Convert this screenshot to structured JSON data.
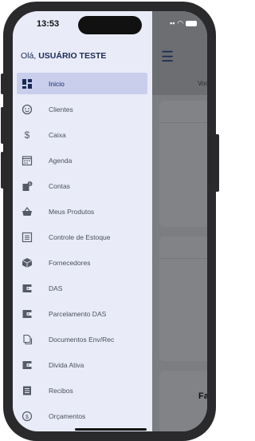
{
  "status_bar": {
    "time": "13:53"
  },
  "greeting": {
    "prefix": "Olá, ",
    "user": "USUÁRIO TESTE"
  },
  "menu": {
    "items": [
      {
        "label": "Inicio",
        "icon": "dashboard-icon",
        "active": true
      },
      {
        "label": "Clientes",
        "icon": "smiley-face-icon",
        "active": false
      },
      {
        "label": "Caixa",
        "icon": "dollar-icon",
        "active": false
      },
      {
        "label": "Agenda",
        "icon": "calendar-icon",
        "active": false
      },
      {
        "label": "Contas",
        "icon": "bill-icon",
        "active": false
      },
      {
        "label": "Meus Produtos",
        "icon": "basket-icon",
        "active": false
      },
      {
        "label": "Controle de Estoque",
        "icon": "inventory-list-icon",
        "active": false
      },
      {
        "label": "Fornecedores",
        "icon": "package-icon",
        "active": false
      },
      {
        "label": "DAS",
        "icon": "wallet-icon",
        "active": false
      },
      {
        "label": "Parcelamento DAS",
        "icon": "wallet-icon",
        "active": false
      },
      {
        "label": "Documentos Env/Rec",
        "icon": "documents-icon",
        "active": false
      },
      {
        "label": "Divida Ativa",
        "icon": "wallet-icon",
        "active": false
      },
      {
        "label": "Recibos",
        "icon": "receipt-icon",
        "active": false
      },
      {
        "label": "Orçamentos",
        "icon": "dollar-circle-icon",
        "active": false
      }
    ]
  },
  "background_app": {
    "partial_text_1": "Voc",
    "partial_text_2": "Fa"
  },
  "colors": {
    "drawer_bg": "#e9ecf8",
    "active_bg": "#c9ceec",
    "brand_navy": "#1b2a55"
  }
}
